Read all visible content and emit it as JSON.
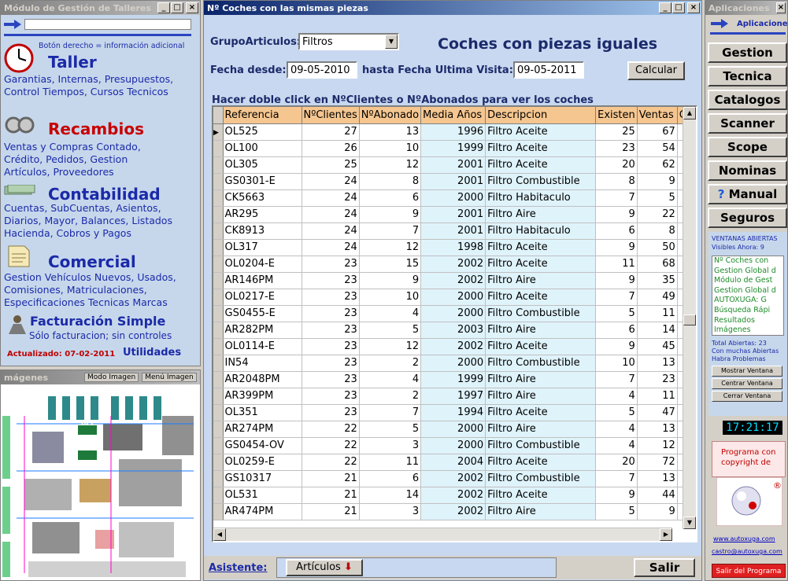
{
  "left_window": {
    "title": "Módulo de Gestión de Talleres",
    "note": "Botón derecho = información adicional",
    "sections": [
      {
        "title": "Taller",
        "text": [
          "Garantias, Internas, Presupuestos,",
          "Control Tiempos, Cursos Tecnicos"
        ]
      },
      {
        "title": "Recambios",
        "text": [
          "Ventas y Compras Contado,",
          "Crédito, Pedidos,  Gestion",
          "Artículos, Proveedores"
        ]
      },
      {
        "title": "Contabilidad",
        "text": [
          "Cuentas, SubCuentas, Asientos,",
          "Diarios, Mayor, Balances, Listados",
          "Hacienda, Cobros y Pagos"
        ]
      },
      {
        "title": "Comercial",
        "text": [
          "Gestion Vehículos Nuevos, Usados,",
          "Comisiones, Matriculaciones,",
          "Especificaciones Tecnicas Marcas"
        ]
      },
      {
        "title": "Facturación Simple",
        "text": [
          "Sólo facturacion; sin controles"
        ]
      }
    ],
    "updated": "Actualizado: 07-02-2011",
    "utilities": "Utilidades"
  },
  "images_window": {
    "title": "mágenes",
    "mode_button": "Modo Imagen",
    "menu_button": "Menú Imagen",
    "labels": [
      "UCE",
      "UCE"
    ]
  },
  "main_window": {
    "title": "Nº Coches con las mismas piezas",
    "heading": "Coches con piezas iguales",
    "group_label": "GrupoArticulos:",
    "group_value": "Filtros",
    "date_from_label": "Fecha desde:",
    "date_from_value": "09-05-2010",
    "date_to_label": "hasta Fecha Ultima Visita:",
    "date_to_value": "09-05-2011",
    "calc_button": "Calcular",
    "hint": "Hacer doble click en NºClientes o NºAbonados para ver los coches",
    "columns": [
      "Referencia",
      "NºClientes",
      "NºAbonado",
      "Media Años",
      "Descripcion",
      "Existen",
      "Ventas",
      "C"
    ],
    "rows": [
      [
        "OL525",
        "27",
        "13",
        "1996",
        "Filtro Aceite",
        "25",
        "67"
      ],
      [
        "OL100",
        "26",
        "10",
        "1999",
        "Filtro Aceite",
        "23",
        "54"
      ],
      [
        "OL305",
        "25",
        "12",
        "2001",
        "Filtro Aceite",
        "20",
        "62"
      ],
      [
        "GS0301-E",
        "24",
        "8",
        "2001",
        "Filtro Combustible",
        "8",
        "9"
      ],
      [
        "CK5663",
        "24",
        "6",
        "2000",
        "Filtro Habitaculo",
        "7",
        "5"
      ],
      [
        "AR295",
        "24",
        "9",
        "2001",
        "Filtro Aire",
        "9",
        "22"
      ],
      [
        "CK8913",
        "24",
        "7",
        "2001",
        "Filtro Habitaculo",
        "6",
        "8"
      ],
      [
        "OL317",
        "24",
        "12",
        "1998",
        "Filtro Aceite",
        "9",
        "50"
      ],
      [
        "OL0204-E",
        "23",
        "15",
        "2002",
        "Filtro Aceite",
        "11",
        "68"
      ],
      [
        "AR146PM",
        "23",
        "9",
        "2002",
        "Filtro Aire",
        "9",
        "35"
      ],
      [
        "OL0217-E",
        "23",
        "10",
        "2000",
        "Filtro Aceite",
        "7",
        "49"
      ],
      [
        "GS0455-E",
        "23",
        "4",
        "2000",
        "Filtro Combustible",
        "5",
        "11"
      ],
      [
        "AR282PM",
        "23",
        "5",
        "2003",
        "Filtro Aire",
        "6",
        "14"
      ],
      [
        "OL0114-E",
        "23",
        "12",
        "2002",
        "Filtro Aceite",
        "9",
        "45"
      ],
      [
        "IN54",
        "23",
        "2",
        "2000",
        "Filtro Combustible",
        "10",
        "13"
      ],
      [
        "AR2048PM",
        "23",
        "4",
        "1999",
        "Filtro Aire",
        "7",
        "23"
      ],
      [
        "AR399PM",
        "23",
        "2",
        "1997",
        "Filtro Aire",
        "4",
        "11"
      ],
      [
        "OL351",
        "23",
        "7",
        "1994",
        "Filtro Aceite",
        "5",
        "47"
      ],
      [
        "AR274PM",
        "22",
        "5",
        "2000",
        "Filtro Aire",
        "4",
        "13"
      ],
      [
        "GS0454-OV",
        "22",
        "3",
        "2000",
        "Filtro Combustible",
        "4",
        "12"
      ],
      [
        "OL0259-E",
        "22",
        "11",
        "2004",
        "Filtro Aceite",
        "20",
        "72"
      ],
      [
        "GS10317",
        "21",
        "6",
        "2002",
        "Filtro Combustible",
        "7",
        "13"
      ],
      [
        "OL531",
        "21",
        "14",
        "2002",
        "Filtro Aceite",
        "9",
        "44"
      ],
      [
        "AR474PM",
        "21",
        "3",
        "2002",
        "Filtro Aire",
        "5",
        "9"
      ]
    ],
    "assistant_label": "Asistente:",
    "articles_button": "Artículos",
    "exit_button": "Salir"
  },
  "right_window": {
    "title": "Aplicaciones",
    "apps_label": "Aplicaciones",
    "nav": [
      "Gestion",
      "Tecnica",
      "Catalogos",
      "Scanner",
      "Scope",
      "Nominas",
      "Manual",
      "Seguros"
    ],
    "open_windows_title": "VENTANAS ABIERTAS",
    "visible_now": "Visibles Ahora: 9",
    "open_list": [
      "Nº Coches con",
      "Gestion Global d",
      "Módulo de Gest",
      "Gestion Global d",
      "AUTOXUGA: G",
      "Búsqueda Rápi",
      "Resultados",
      "Imágenes"
    ],
    "total_open": "Total Abiertas: 23",
    "warning": [
      "Con muchas Abiertas",
      "Habra Problemas"
    ],
    "show_window": "Mostrar Ventana",
    "center_window": "Centrar Ventana",
    "close_window": "Cerrar Ventana",
    "clock": "17:21:17",
    "copyright": [
      "Programa con",
      "copyright de"
    ],
    "website": "www.autoxuga.com",
    "email": "castro@autoxuga.com",
    "exit_program": "Salir del Programa"
  }
}
